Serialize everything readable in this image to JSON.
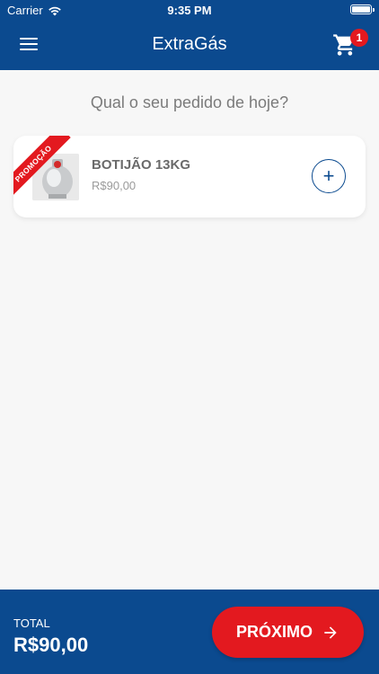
{
  "status_bar": {
    "carrier": "Carrier",
    "time": "9:35 PM"
  },
  "header": {
    "title": "ExtraGás",
    "cart_count": "1"
  },
  "main": {
    "prompt": "Qual o seu pedido de hoje?",
    "products": [
      {
        "name": "BOTIJÃO 13KG",
        "price": "R$90,00",
        "ribbon": "PROMOÇÃO",
        "add_symbol": "+"
      }
    ]
  },
  "footer": {
    "total_label": "TOTAL",
    "total_value": "R$90,00",
    "next_label": "PRÓXIMO"
  },
  "colors": {
    "brand": "#0b4a8f",
    "accent": "#e3191f",
    "background": "#f7f7f7"
  },
  "icons": [
    "wifi-icon",
    "battery-icon",
    "menu-icon",
    "cart-icon",
    "plus-icon",
    "arrow-right-icon"
  ]
}
